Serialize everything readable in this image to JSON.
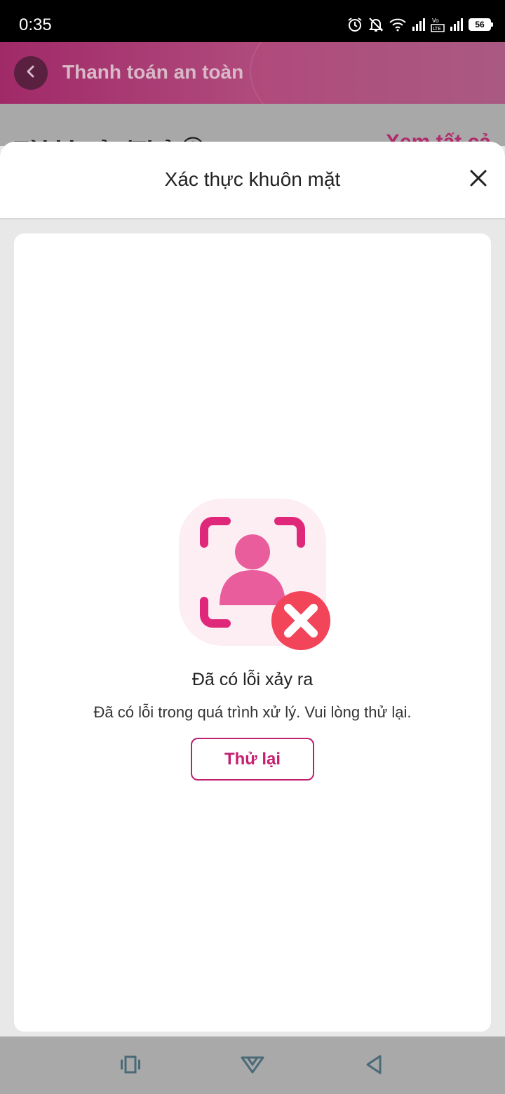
{
  "status_bar": {
    "time": "0:35",
    "battery": "56",
    "icons": [
      "alarm-icon",
      "bell-off-icon",
      "wifi-icon",
      "signal-icon",
      "volte-icon",
      "signal-icon",
      "battery-icon"
    ]
  },
  "app_bar": {
    "title": "Thanh toán an toàn",
    "back_icon": "chevron-left-icon"
  },
  "background": {
    "left_text": "Tài khoản/Thẻ ⓘ",
    "right_link": "Xem tất cả"
  },
  "sheet": {
    "title": "Xác thực khuôn mặt",
    "close_icon": "close-icon"
  },
  "error": {
    "icon": "face-scan-error-icon",
    "title": "Đã có lỗi xảy ra",
    "message": "Đã có lỗi trong quá trình xử lý. Vui lòng thử lại.",
    "retry_label": "Thử lại"
  },
  "nav_bar": {
    "icons": [
      "recent-apps-icon",
      "home-icon",
      "back-icon"
    ]
  },
  "colors": {
    "accent": "#c41f70",
    "error_red": "#f2455a",
    "face_pink": "#e95d9c",
    "app_bar": "#a82d6b"
  }
}
